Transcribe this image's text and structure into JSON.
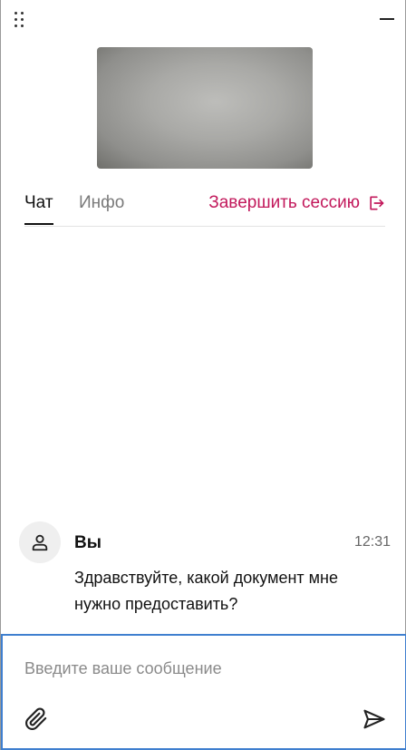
{
  "header": {
    "drag_icon": "drag-handle-icon",
    "minimize_icon": "minimize-icon"
  },
  "tabs": [
    {
      "label": "Чат",
      "active": true
    },
    {
      "label": "Инфо",
      "active": false
    }
  ],
  "end_session": {
    "label": "Завершить сессию",
    "icon": "logout-icon",
    "color": "#c2185b"
  },
  "messages": [
    {
      "sender": "Вы",
      "time": "12:31",
      "text": "Здравствуйте, какой документ мне нужно предоставить?",
      "avatar_icon": "user-icon"
    }
  ],
  "composer": {
    "placeholder": "Введите ваше сообщение",
    "value": "",
    "attach_icon": "paperclip-icon",
    "send_icon": "send-icon",
    "focus_color": "#3f7fcf"
  }
}
